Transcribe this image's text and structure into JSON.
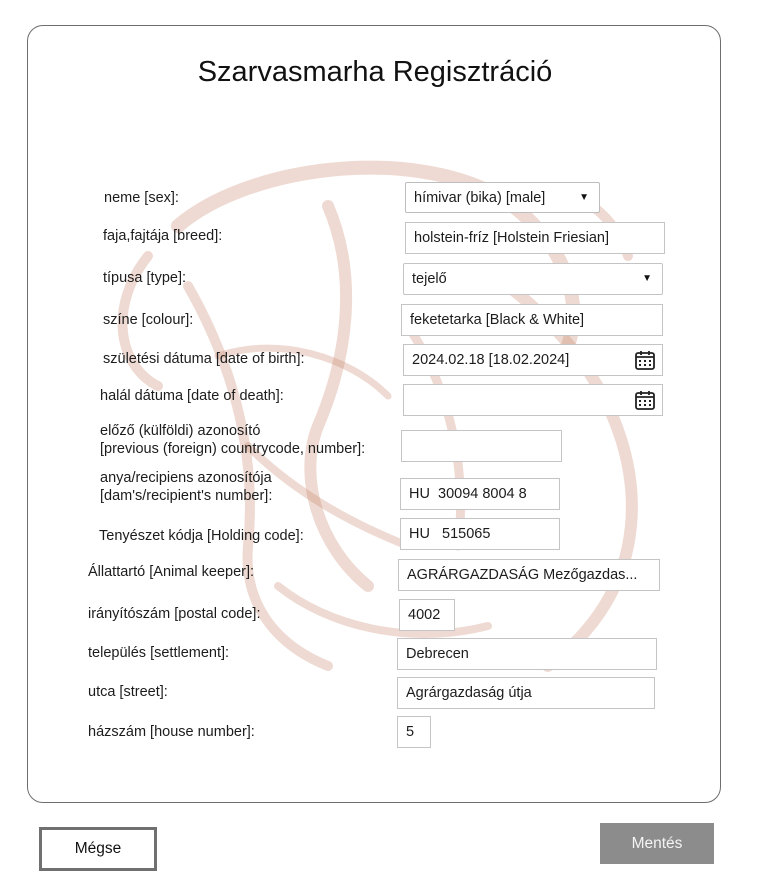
{
  "form": {
    "title": "Szarvasmarha Regisztráció",
    "fields": {
      "sex": {
        "label": "neme [sex]:",
        "value": "hímivar (bika) [male]"
      },
      "breed": {
        "label": "faja,fajtája [breed]:",
        "value": "holstein-fríz [Holstein Friesian]"
      },
      "type": {
        "label": "típusa [type]:",
        "value": "tejelő"
      },
      "colour": {
        "label": "színe [colour]:",
        "value": "feketetarka [Black & White]"
      },
      "dob": {
        "label": "születési dátuma [date of birth]:",
        "value": "2024.02.18 [18.02.2024]"
      },
      "dod": {
        "label": "halál dátuma [date of death]:",
        "value": ""
      },
      "prev_id": {
        "label_1": "előző (külföldi) azonosító",
        "label_2": "[previous (foreign) countrycode, number]:",
        "value": ""
      },
      "dam": {
        "label_1": "anya/recipiens azonosítója",
        "label_2": "[dam's/recipient's number]:",
        "value": "HU  30094 8004 8"
      },
      "holding": {
        "label": "Tenyészet kódja [Holding code]:",
        "value": "HU   515065"
      },
      "keeper": {
        "label": "Állattartó [Animal keeper]:",
        "value": "AGRÁRGAZDASÁG Mezőgazdas..."
      },
      "postal": {
        "label": "irányítószám [postal code]:",
        "value": "4002"
      },
      "settlement": {
        "label": "település [settlement]:",
        "value": "Debrecen"
      },
      "street": {
        "label": "utca [street]:",
        "value": "Agrárgazdaság útja"
      },
      "house_number": {
        "label": "házszám [house number]:",
        "value": "5"
      }
    }
  },
  "buttons": {
    "cancel": "Mégse",
    "save": "Mentés"
  },
  "icons": {
    "select_arrow": "dropdown-arrow-icon",
    "calendar": "calendar-icon"
  },
  "colors": {
    "save_button": "#8c8c8c",
    "watermark": "#b0583a"
  }
}
